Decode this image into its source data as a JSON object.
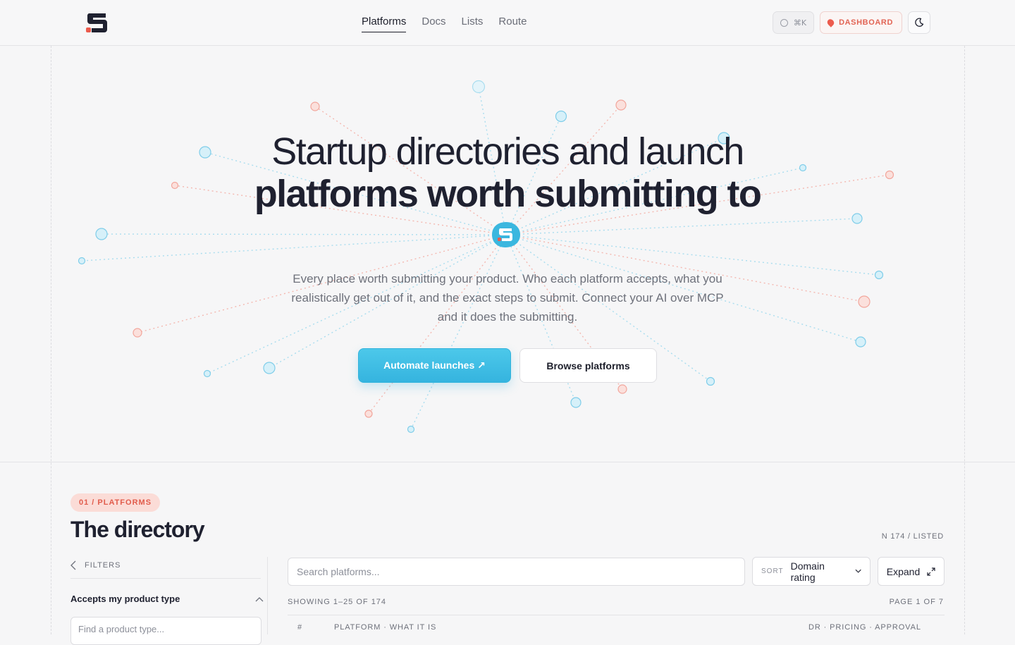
{
  "nav": {
    "links": [
      "Platforms",
      "Docs",
      "Lists",
      "Route"
    ],
    "active": "Platforms",
    "shortcut_label": "⌘K",
    "dashboard_label": "DASHBOARD"
  },
  "hero": {
    "title_line1": "Startup directories and launch",
    "title_line2": "platforms worth submitting to",
    "subtitle": "Every place worth submitting your product. Who each platform accepts, what you realistically get out of it, and the exact steps to submit. Connect your AI over MCP and it does the submitting.",
    "cta_primary": "Automate launches ↗",
    "cta_secondary": "Browse platforms"
  },
  "directory": {
    "section_tag": "01 / PLATFORMS",
    "title": "The directory",
    "count_label": "N 174 / LISTED",
    "filters_label": "FILTERS",
    "filter_group_title": "Accepts my product type",
    "product_type_placeholder": "Find a product type...",
    "search_placeholder": "Search platforms...",
    "sort_label": "SORT",
    "sort_value": "Domain rating",
    "expand_label": "Expand",
    "showing_label": "SHOWING 1–25 OF 174",
    "page_label": "PAGE 1 OF 7",
    "table_headers": {
      "index": "#",
      "platform": "PLATFORM · WHAT IT IS",
      "meta": "DR · PRICING · APPROVAL"
    }
  },
  "colors": {
    "accent_blue": "#3ab8e0",
    "accent_red": "#e6594a",
    "text_dark": "#1f2130"
  }
}
